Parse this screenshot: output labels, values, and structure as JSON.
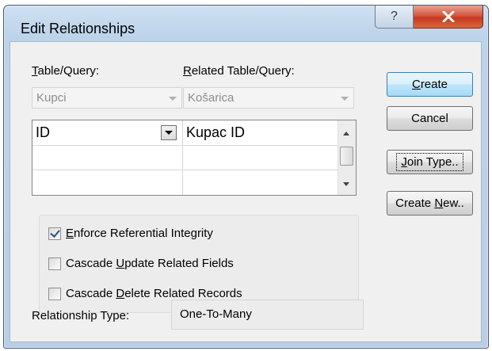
{
  "window": {
    "title": "Edit Relationships",
    "help_glyph": "?",
    "close_glyph": "x"
  },
  "table_query": {
    "label_first": "T",
    "label_rest": "able/Query:",
    "value": "Kupci"
  },
  "related_query": {
    "label_first": "R",
    "label_rest": "elated Table/Query:",
    "value": "Košarica"
  },
  "field_grid": {
    "rows": [
      {
        "left": "ID",
        "right": "Kupac ID"
      },
      {
        "left": "",
        "right": ""
      },
      {
        "left": "",
        "right": ""
      }
    ]
  },
  "options": {
    "enforce": {
      "pre": "",
      "key": "E",
      "post": "nforce Referential Integrity",
      "checked": true
    },
    "cascade_update": {
      "pre": "Cascade ",
      "key": "U",
      "post": "pdate Related Fields",
      "checked": false
    },
    "cascade_delete": {
      "pre": "Cascade ",
      "key": "D",
      "post": "elete Related Records",
      "checked": false
    }
  },
  "relationship_type": {
    "label": "Relationship Type:",
    "value": "One-To-Many"
  },
  "buttons": {
    "create": {
      "pre": "",
      "key": "C",
      "post": "reate"
    },
    "cancel": {
      "label": "Cancel"
    },
    "join_type": {
      "pre": "",
      "key": "J",
      "post": "oin Type.."
    },
    "create_new": {
      "pre": "Create ",
      "key": "N",
      "post": "ew.."
    }
  },
  "colors": {
    "default_button_border": "#3c7fb1",
    "close_button": "#c3391f",
    "titlebar": "#bdd3ea"
  }
}
